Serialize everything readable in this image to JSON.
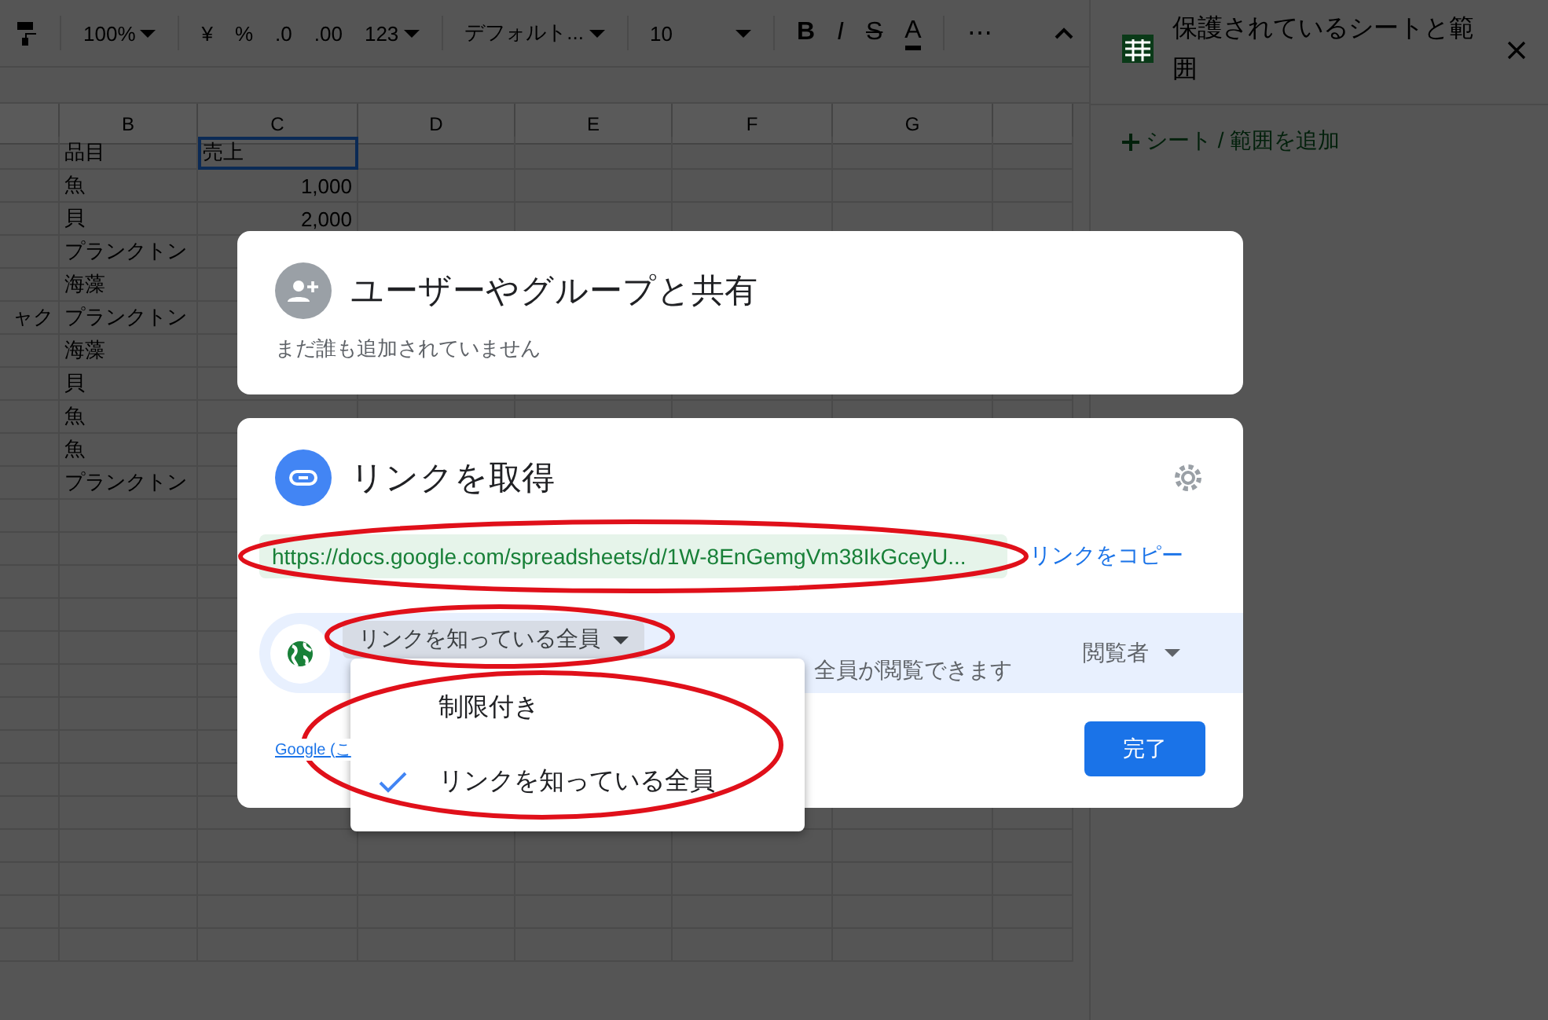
{
  "toolbar": {
    "zoom": "100%",
    "currency": "¥",
    "percent": "%",
    "decrease_decimals": ".0",
    "increase_decimals": ".00",
    "number_format": "123",
    "font": "デフォルト...",
    "font_size": "10",
    "bold": "B",
    "italic": "I",
    "strikethrough": "S",
    "text_color": "A",
    "more": "⋯"
  },
  "sheet": {
    "columns": [
      "B",
      "C",
      "D",
      "E",
      "F",
      "G"
    ],
    "rows": [
      {
        "b": "品目",
        "c": "売上",
        "c_selected": true
      },
      {
        "b": "魚",
        "c": "1,000",
        "c_selected": false
      },
      {
        "b": "貝",
        "c": "2,000",
        "c_selected": false
      },
      {
        "b": "プランクトン",
        "c_selected": false
      },
      {
        "b": "海藻",
        "c_selected": false
      },
      {
        "a": "ャク",
        "b": "プランクトン",
        "c_selected": false
      },
      {
        "b": "海藻",
        "c_selected": false
      },
      {
        "b": "貝",
        "c_selected": false
      },
      {
        "b": "魚",
        "c_selected": false
      },
      {
        "b": "魚",
        "c_selected": false
      },
      {
        "b": "プランクトン",
        "c_selected": false
      }
    ]
  },
  "sidebar": {
    "title": "保護されているシートと範囲",
    "add": "シート / 範囲を追加"
  },
  "share_card": {
    "title": "ユーザーやグループと共有",
    "subtitle": "まだ誰も追加されていません"
  },
  "link_card": {
    "title": "リンクを取得",
    "url": "https://docs.google.com/spreadsheets/d/1W-8EnGemgVm38IkGceyU...",
    "url_circled": true,
    "copy": "リンクをコピー",
    "access": "リンクを知っている全員",
    "access_circled": true,
    "description": "全員が閲覧できます",
    "role": "閲覧者",
    "help_link": "Google (こ",
    "done": "完了"
  },
  "access_menu": {
    "circled": true,
    "items": [
      {
        "label": "制限付き",
        "selected": false
      },
      {
        "label": "リンクを知っている全員",
        "selected": true
      }
    ]
  }
}
